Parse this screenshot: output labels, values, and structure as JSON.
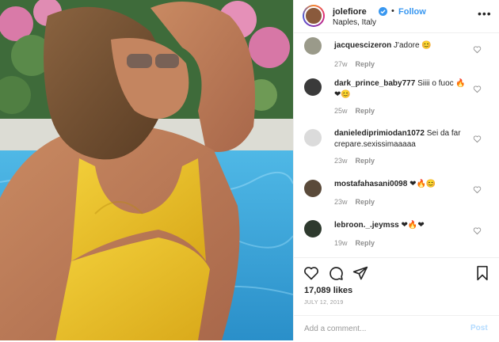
{
  "post": {
    "username": "jolefiore",
    "verified": true,
    "separator": "•",
    "follow_label": "Follow",
    "location": "Naples, Italy",
    "more_icon": "more-options-icon",
    "more_label": "•••"
  },
  "comments": [
    {
      "username": "jacquescizeron",
      "text": "J'adore 😊",
      "age": "27w",
      "reply": "Reply",
      "avatar_color": "#9a9a8a"
    },
    {
      "username": "dark_prince_baby777",
      "text": "Siiii o fuoc 🔥❤😊",
      "age": "25w",
      "reply": "Reply",
      "avatar_color": "#3a3a3a"
    },
    {
      "username": "danielediprimiodan1072",
      "text": "Sei da far crepare.sexissimaaaaa",
      "age": "23w",
      "reply": "Reply",
      "avatar_color": "#dbdbdb"
    },
    {
      "username": "mostafahasani0098",
      "text": "❤🔥😊",
      "age": "23w",
      "reply": "Reply",
      "avatar_color": "#5a4a3a"
    },
    {
      "username": "lebroon._.jeymss",
      "text": "❤🔥❤",
      "age": "19w",
      "reply": "Reply",
      "avatar_color": "#2e3a2e"
    }
  ],
  "actions": {
    "likes": "17,089 likes",
    "date": "JULY 12, 2019",
    "icons": [
      "heart-icon",
      "comment-icon",
      "share-icon",
      "bookmark-icon"
    ]
  },
  "add_comment": {
    "placeholder": "Add a comment...",
    "post_label": "Post"
  },
  "colors": {
    "accent": "#3897f0",
    "post_disabled": "#b3dbff",
    "secondary_text": "#8e8e8e",
    "border": "#efefef"
  }
}
